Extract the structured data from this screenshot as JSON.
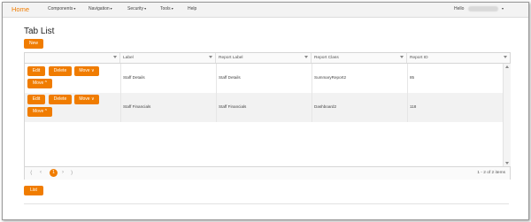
{
  "nav": {
    "home": "Home",
    "items": [
      {
        "label": "Components",
        "caret": "▾"
      },
      {
        "label": "Navigation",
        "caret": "▾"
      },
      {
        "label": "Security",
        "caret": "▾"
      },
      {
        "label": "Tools",
        "caret": "▾"
      },
      {
        "label": "Help",
        "caret": ""
      }
    ],
    "greeting": "Hello"
  },
  "page": {
    "title": "Tab List",
    "new_label": "New",
    "list_label": "List"
  },
  "grid": {
    "columns": [
      "",
      "Label",
      "Report Label",
      "Report Class",
      "Report ID"
    ],
    "row_actions": {
      "edit": "Edit",
      "delete": "Delete",
      "move_down": "Move ∨",
      "move_up": "Move ^"
    },
    "rows": [
      {
        "label": "Staff Details",
        "report_label": "Staff Details",
        "report_class": "SummaryReport2",
        "report_id": "85"
      },
      {
        "label": "Staff Financials",
        "report_label": "Staff Financials",
        "report_class": "Dashboard2",
        "report_id": "118"
      }
    ],
    "pager": {
      "first": "⟨",
      "prev": "‹",
      "current": "1",
      "next": "›",
      "last": "⟩",
      "info": "1 - 2 of 2 items"
    }
  },
  "colors": {
    "accent": "#f07c00"
  }
}
